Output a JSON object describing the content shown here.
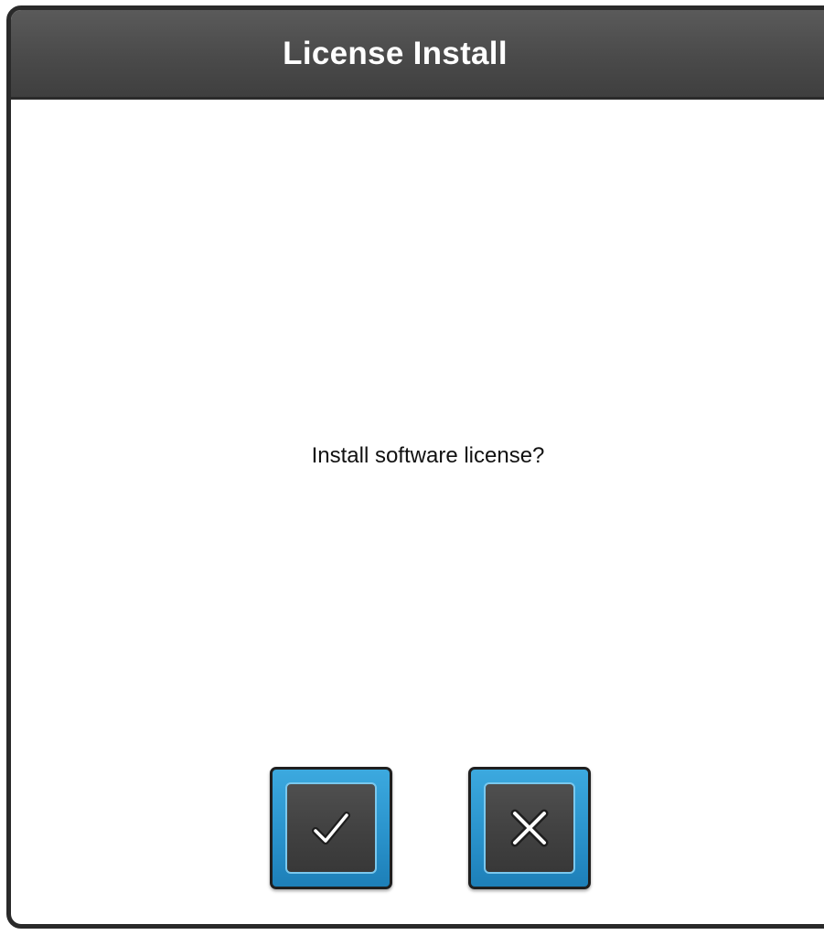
{
  "dialog": {
    "title": "License Install",
    "message": "Install software license?"
  },
  "buttons": {
    "confirm": {
      "icon": "checkmark-icon"
    },
    "cancel": {
      "icon": "close-icon"
    }
  },
  "colors": {
    "titlebar": "#4a4a4a",
    "button_accent": "#2a93cc",
    "button_face": "#424242"
  }
}
